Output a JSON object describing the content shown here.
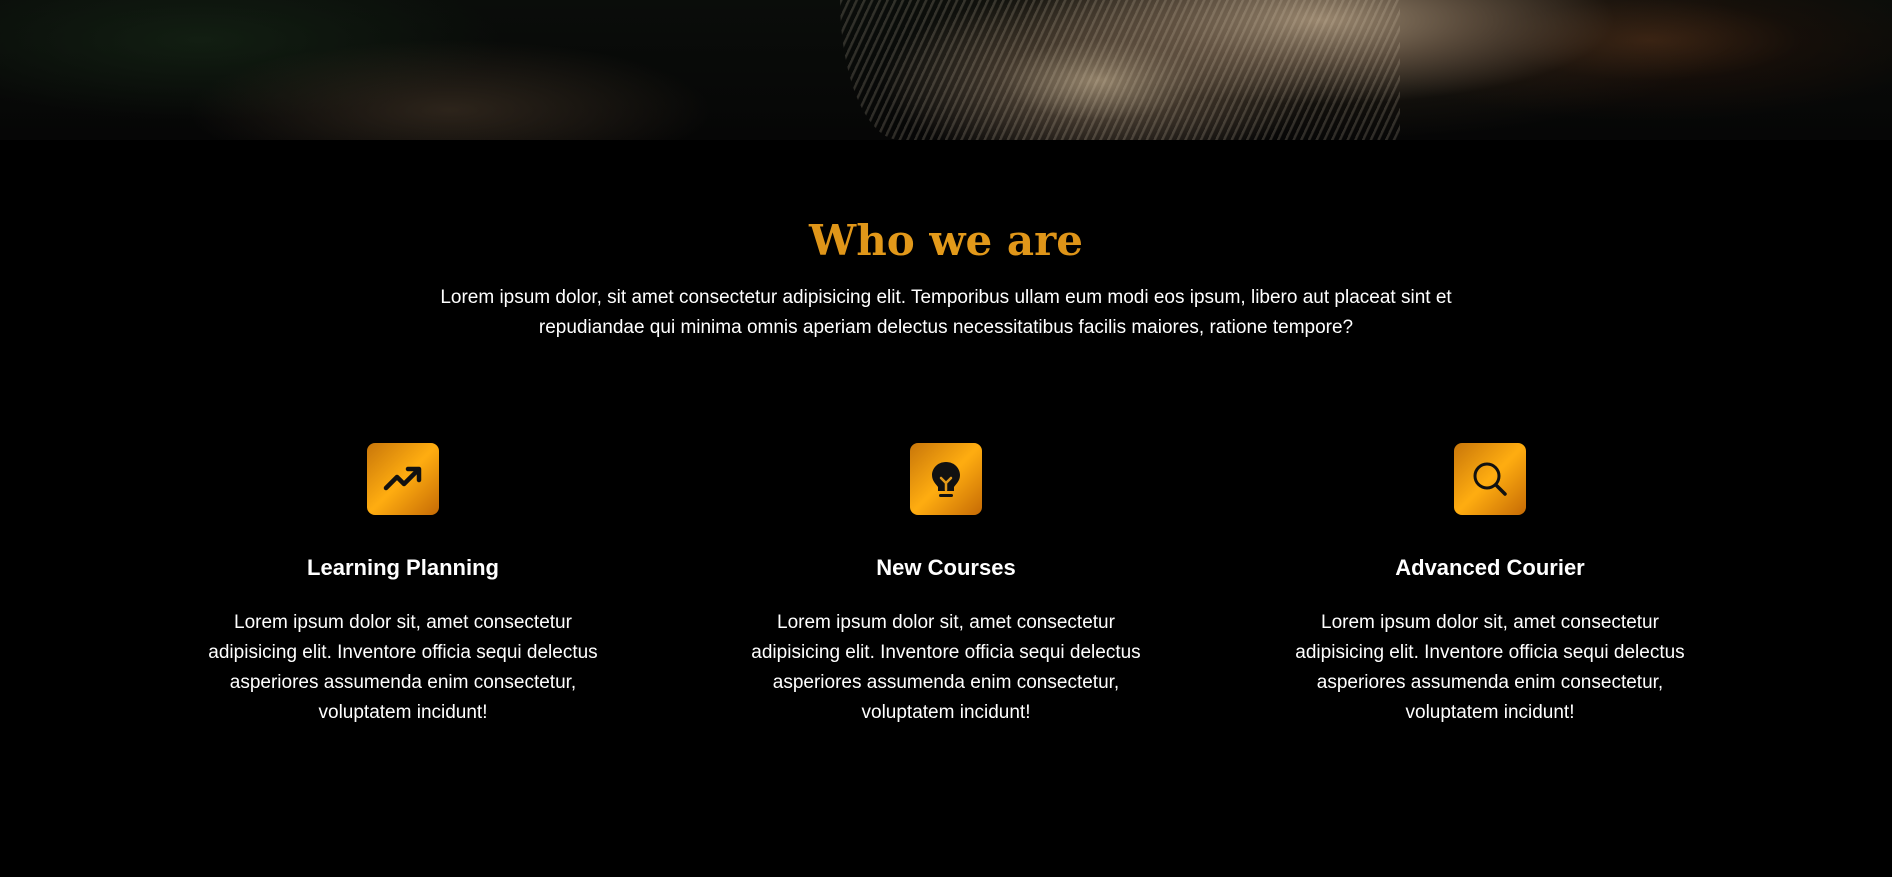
{
  "section": {
    "title": "Who we are",
    "intro": "Lorem ipsum dolor, sit amet consectetur adipisicing elit. Temporibus ullam eum modi eos ipsum, libero aut placeat sint et repudiandae qui minima omnis aperiam delectus necessitatibus facilis maiores, ratione tempore?"
  },
  "features": [
    {
      "icon": "trending-up-icon",
      "title": "Learning Planning",
      "text": "Lorem ipsum dolor sit, amet consectetur adipisicing elit. Inventore officia sequi delectus asperiores assumenda enim consectetur, voluptatem incidunt!"
    },
    {
      "icon": "lightbulb-icon",
      "title": "New Courses",
      "text": "Lorem ipsum dolor sit, amet consectetur adipisicing elit. Inventore officia sequi delectus asperiores assumenda enim consectetur, voluptatem incidunt!"
    },
    {
      "icon": "search-icon",
      "title": "Advanced Courier",
      "text": "Lorem ipsum dolor sit, amet consectetur adipisicing elit. Inventore officia sequi delectus asperiores assumenda enim consectetur, voluptatem incidunt!"
    }
  ],
  "colors": {
    "background": "#000000",
    "accent": "#d98a12",
    "text": "#ffffff"
  }
}
